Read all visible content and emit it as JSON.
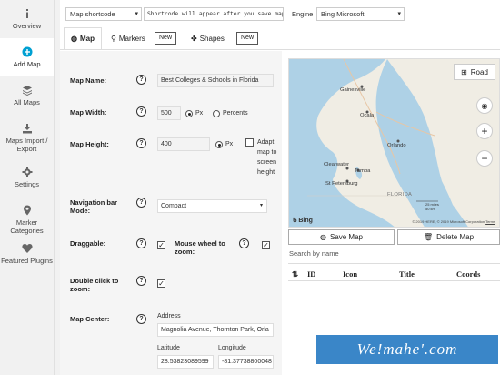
{
  "sidebar": {
    "items": [
      {
        "label": "Overview",
        "icon": "info-icon"
      },
      {
        "label": "Add Map",
        "icon": "plus-circle-icon",
        "active": true
      },
      {
        "label": "All Maps",
        "icon": "layers-icon"
      },
      {
        "label": "Maps Import / Export",
        "icon": "download-icon"
      },
      {
        "label": "Settings",
        "icon": "gear-icon"
      },
      {
        "label": "Marker Categories",
        "icon": "map-pin-icon"
      },
      {
        "label": "Featured Plugins",
        "icon": "heart-icon"
      }
    ]
  },
  "topbar": {
    "shortcode_select": "Map shortcode",
    "shortcode_text": "Shortcode will appear after you save map",
    "engine_label": "Engine",
    "engine_value": "Bing Microsoft"
  },
  "tabs": {
    "map": "Map",
    "markers": "Markers",
    "markers_new": "New",
    "shapes": "Shapes",
    "shapes_new": "New"
  },
  "form": {
    "map_name_label": "Map Name:",
    "map_name_value": "Best Colleges & Schools in Florida",
    "map_width_label": "Map Width:",
    "map_width_value": "500",
    "unit_px": "Px",
    "unit_percents": "Percents",
    "map_height_label": "Map Height:",
    "map_height_value": "400",
    "height_unit_px": "Px",
    "adapt_label": "Adapt map to screen height",
    "navbar_label": "Navigation bar Mode:",
    "navbar_value": "Compact",
    "draggable_label": "Draggable:",
    "mousewheel_label": "Mouse wheel to zoom:",
    "dblclick_label": "Double click to zoom:",
    "center_label": "Map Center:",
    "address_label": "Address",
    "address_value": "Magnolia Avenue, Thornton Park, Orla",
    "latitude_label": "Latitude",
    "latitude_value": "28.53823089599",
    "longitude_label": "Longitude",
    "longitude_value": "-81.37738800048",
    "help_symbol": "?"
  },
  "map": {
    "road_label": "Road",
    "cities": {
      "gainesville": "Gainesville",
      "ocala": "Ocala",
      "orlando": "Orlando",
      "clearwater": "Clearwater",
      "tampa": "Tampa",
      "st_petersburg": "St Petersburg",
      "florida": "FLORIDA"
    },
    "attribution": "© 2019 HERE, © 2019 Microsoft Corporation",
    "terms": "Terms",
    "scale_mi": "25 miles",
    "scale_km": "50 km",
    "bing": "Bing",
    "land_color": "#f0ede4",
    "water_color": "#aed1e6"
  },
  "actions": {
    "save_map": "Save Map",
    "delete_map": "Delete Map",
    "search_placeholder": "Search by name"
  },
  "shapes_table": {
    "columns": [
      "ID",
      "Icon",
      "Title",
      "Coords"
    ]
  },
  "watermark": "We!mahe'.com"
}
